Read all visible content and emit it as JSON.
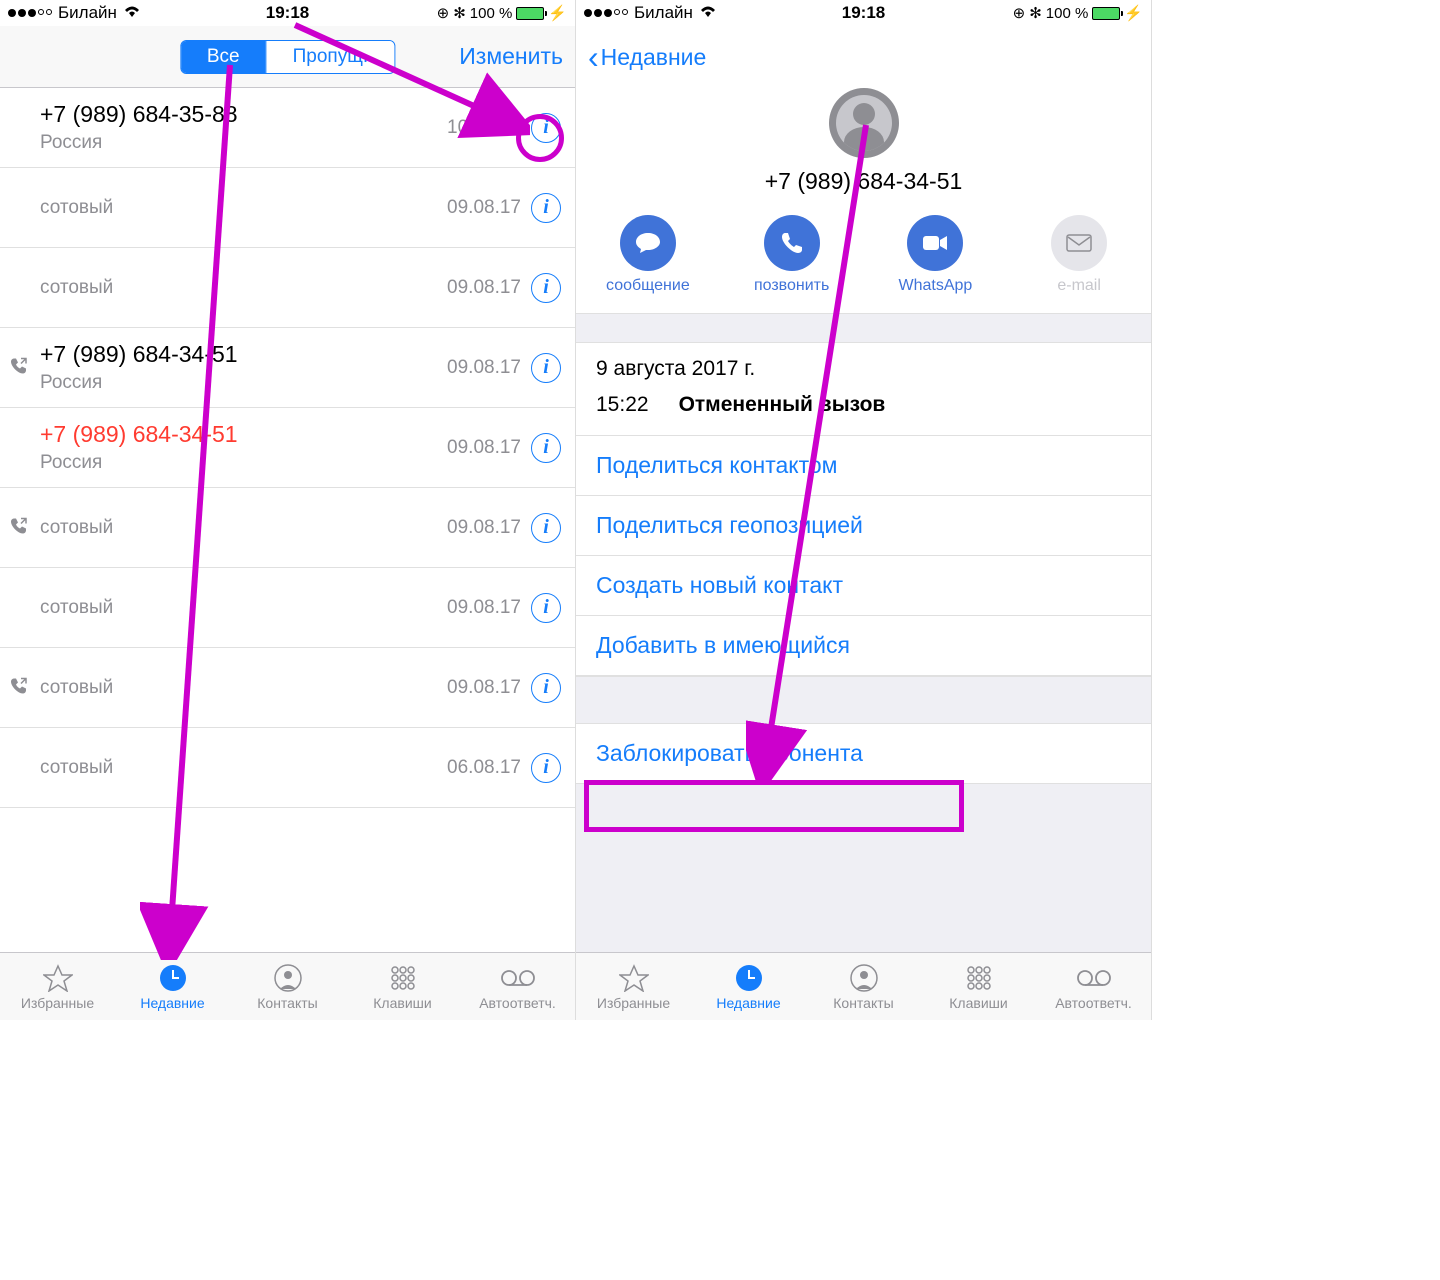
{
  "status_bar": {
    "carrier": "Билайн",
    "time": "19:18",
    "battery_text": "100 %"
  },
  "left_screen": {
    "seg_all": "Все",
    "seg_missed": "Пропущ.",
    "edit": "Изменить",
    "rows": [
      {
        "title": "+7 (989) 684-35-88",
        "sub": "Россия",
        "date": "10.08.17",
        "outgoing": false,
        "missed": false
      },
      {
        "title": "",
        "sub": "сотовый",
        "date": "09.08.17",
        "outgoing": false,
        "missed": false
      },
      {
        "title": "",
        "sub": "сотовый",
        "date": "09.08.17",
        "outgoing": false,
        "missed": false
      },
      {
        "title": "+7 (989) 684-34-51",
        "sub": "Россия",
        "date": "09.08.17",
        "outgoing": true,
        "missed": false
      },
      {
        "title": "+7 (989) 684-34-51",
        "sub": "Россия",
        "date": "09.08.17",
        "outgoing": false,
        "missed": true
      },
      {
        "title": "",
        "sub": "сотовый",
        "date": "09.08.17",
        "outgoing": true,
        "missed": false
      },
      {
        "title": "",
        "sub": "сотовый",
        "date": "09.08.17",
        "outgoing": false,
        "missed": false
      },
      {
        "title": "",
        "sub": "сотовый",
        "date": "09.08.17",
        "outgoing": true,
        "missed": false
      },
      {
        "title": "",
        "sub": "сотовый",
        "date": "06.08.17",
        "outgoing": false,
        "missed": false
      }
    ]
  },
  "right_screen": {
    "back": "Недавние",
    "contact_phone": "+7 (989) 684-34-51",
    "actions": {
      "message": "сообщение",
      "call": "позвонить",
      "whatsapp": "WhatsApp",
      "email": "e-mail"
    },
    "call_log": {
      "date": "9 августа 2017 г.",
      "time": "15:22",
      "type": "Отмененный вызов"
    },
    "links": {
      "share_contact": "Поделиться контактом",
      "share_location": "Поделиться геопозицией",
      "create_contact": "Создать новый контакт",
      "add_existing": "Добавить в имеющийся",
      "block": "Заблокировать абонента"
    }
  },
  "tabs": {
    "favorites": "Избранные",
    "recents": "Недавние",
    "contacts": "Контакты",
    "keypad": "Клавиши",
    "voicemail": "Автоответч."
  }
}
